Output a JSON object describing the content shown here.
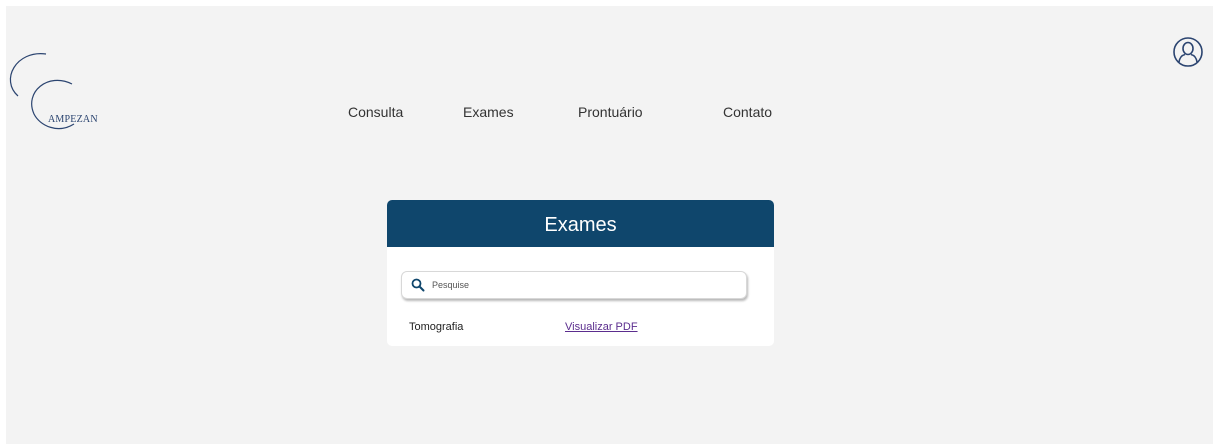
{
  "brand": {
    "name": "AMPEZAN",
    "color": "#2b4470"
  },
  "nav": {
    "items": [
      {
        "label": "Consulta"
      },
      {
        "label": "Exames"
      },
      {
        "label": "Prontuário"
      },
      {
        "label": "Contato"
      }
    ]
  },
  "user": {
    "icon": "user-icon"
  },
  "card": {
    "title": "Exames",
    "header_color": "#0f466c",
    "search": {
      "placeholder": "Pesquise",
      "value": "",
      "icon": "search-icon"
    },
    "results": [
      {
        "name": "Tomografia",
        "action": "Visualizar PDF"
      }
    ]
  }
}
